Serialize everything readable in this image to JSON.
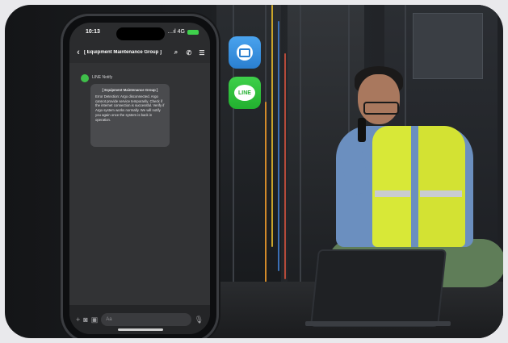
{
  "phone": {
    "status_time": "10:13",
    "status_signal": "…ıl 4G",
    "chat_title": "[ Equipment Maintenance Group ]",
    "sender": "LINE Notify",
    "message_head": "[ Equipment Maintenance Group ]",
    "message_body": "Error Detection: Argo disconnected. Argo cannot provide service temporarily. Check if the internet connection is successful. Verify if Argo system works normally. We will notify you again once the system is back in operation.",
    "input_placeholder": "Aa"
  },
  "apps": {
    "mail_icon": "mail-icon",
    "line_label": "LINE"
  },
  "colors": {
    "line_green": "#22b02f",
    "mail_blue": "#2a7fd0",
    "vest_yellow": "#d8e837"
  }
}
